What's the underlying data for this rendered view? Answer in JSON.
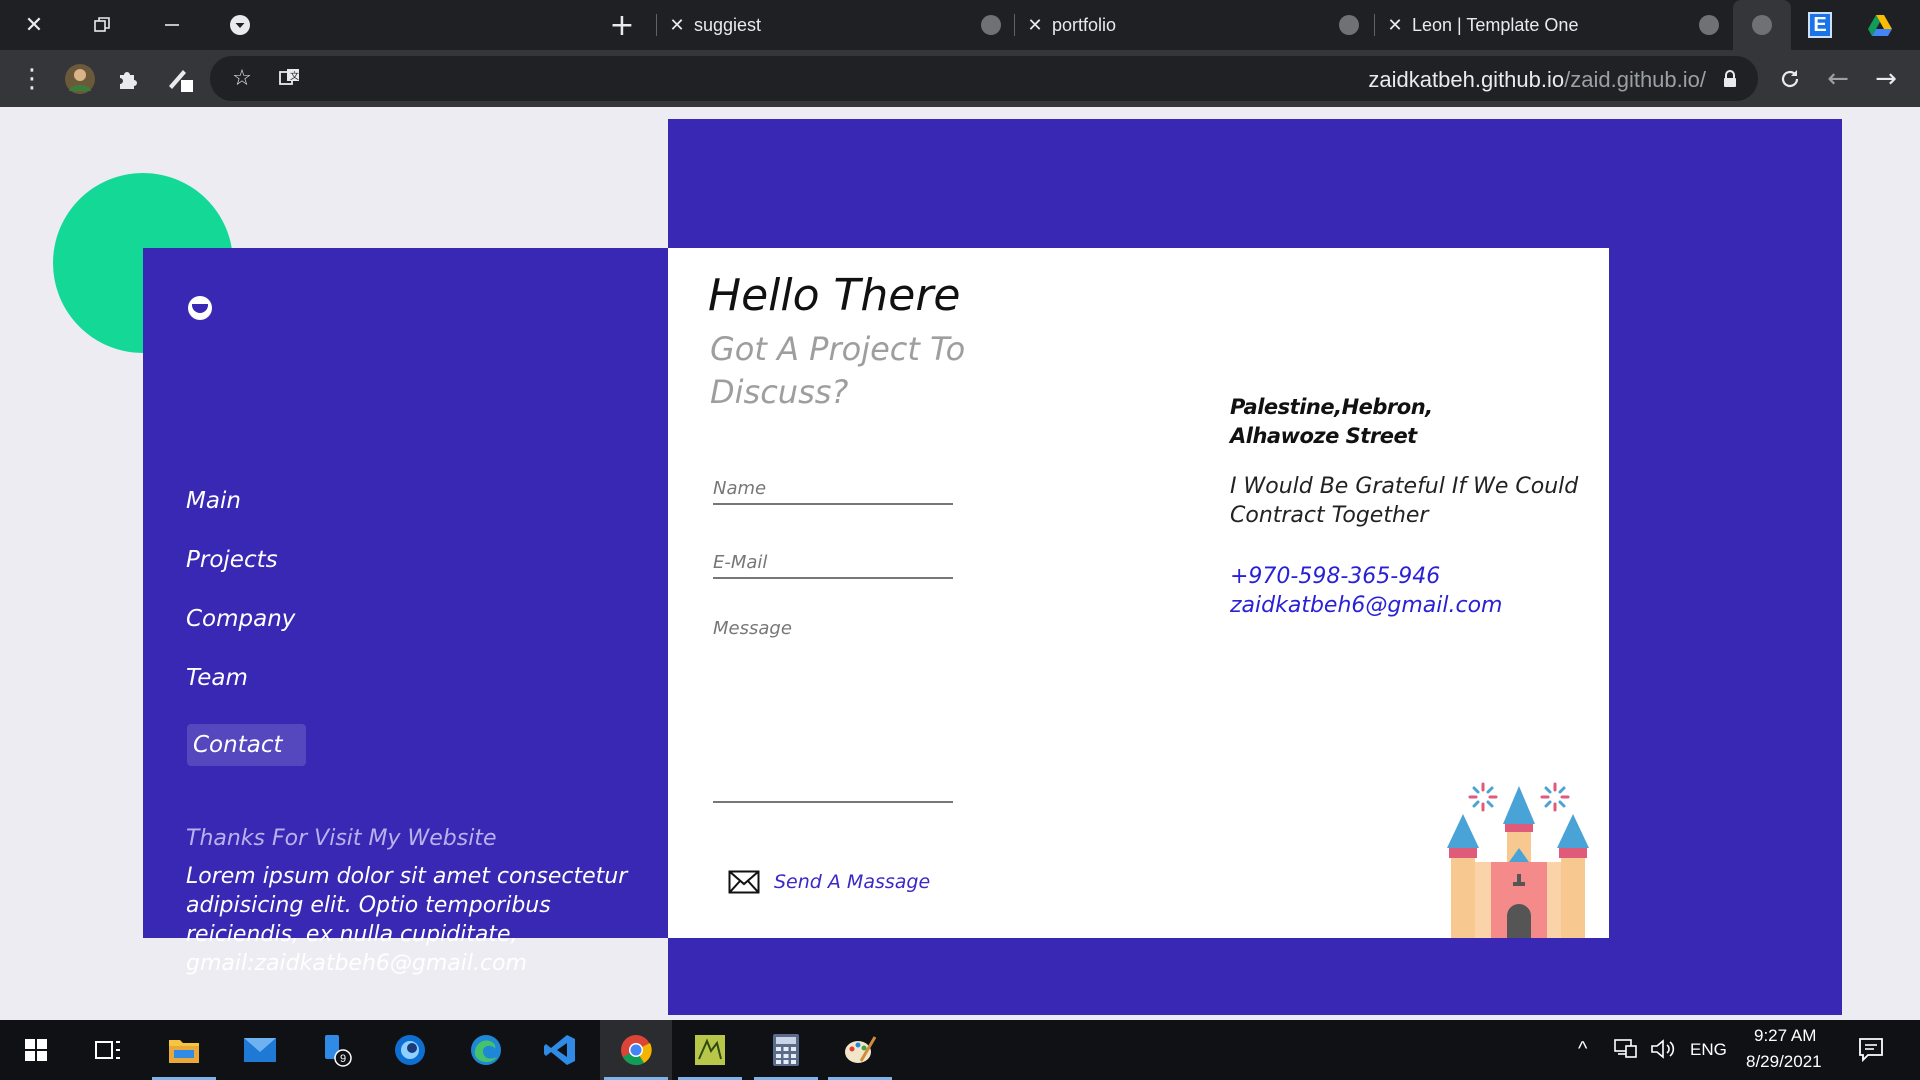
{
  "browser": {
    "tabs": [
      {
        "title": "suggiest"
      },
      {
        "title": "portfolio"
      },
      {
        "title": "Leon | Template One"
      }
    ],
    "new_tab_symbol": "+",
    "url_domain": "zaidkatbeh.github.io",
    "url_path": "/zaid.github.io/",
    "extension_badge": "E",
    "icons": [
      "close-window-icon",
      "restore-icon",
      "minimize-icon",
      "tab-search-icon",
      "new-tab-icon",
      "menu-icon",
      "extension-avatar-icon",
      "puzzle-icon",
      "pen-icon",
      "star-icon",
      "translate-icon",
      "lock-icon",
      "reload-icon",
      "back-icon",
      "forward-icon"
    ]
  },
  "sidebar": {
    "nav": [
      {
        "label": "Main"
      },
      {
        "label": "Projects"
      },
      {
        "label": "Company"
      },
      {
        "label": "Team"
      },
      {
        "label": "Contact"
      }
    ],
    "active": "Contact",
    "thanks_title": "Thanks For Visit My Website",
    "thanks_text": "Lorem ipsum dolor sit amet consectetur adipisicing elit. Optio temporibus reiciendis, ex nulla cupiditate, gmail:zaidkatbeh6@gmail.com"
  },
  "contact": {
    "hello": "Hello There",
    "subtitle": "Got A Project To Discuss?",
    "name_placeholder": "Name",
    "email_placeholder": "E-Mail",
    "message_placeholder": "Message",
    "send_label": "Send A Massage",
    "address": "Palestine,Hebron, Alhawoze Street",
    "grateful": "I Would Be Grateful If We Could Contract Together",
    "phone": "+970-598-365-946",
    "email": "zaidkatbeh6@gmail.com"
  },
  "colors": {
    "primary": "#3828b4",
    "accent_green": "#14d896",
    "link_blue": "#2a20d6"
  },
  "taskbar": {
    "apps": [
      "start-icon",
      "task-view-icon",
      "file-explorer-icon",
      "mail-icon",
      "phone-link-icon",
      "cortana-icon",
      "edge-icon",
      "vscode-icon",
      "chrome-icon",
      "logisim-icon",
      "calculator-icon",
      "paint-icon"
    ],
    "phone_badge": "9",
    "language": "ENG",
    "time": "9:27 AM",
    "date": "8/29/2021"
  }
}
